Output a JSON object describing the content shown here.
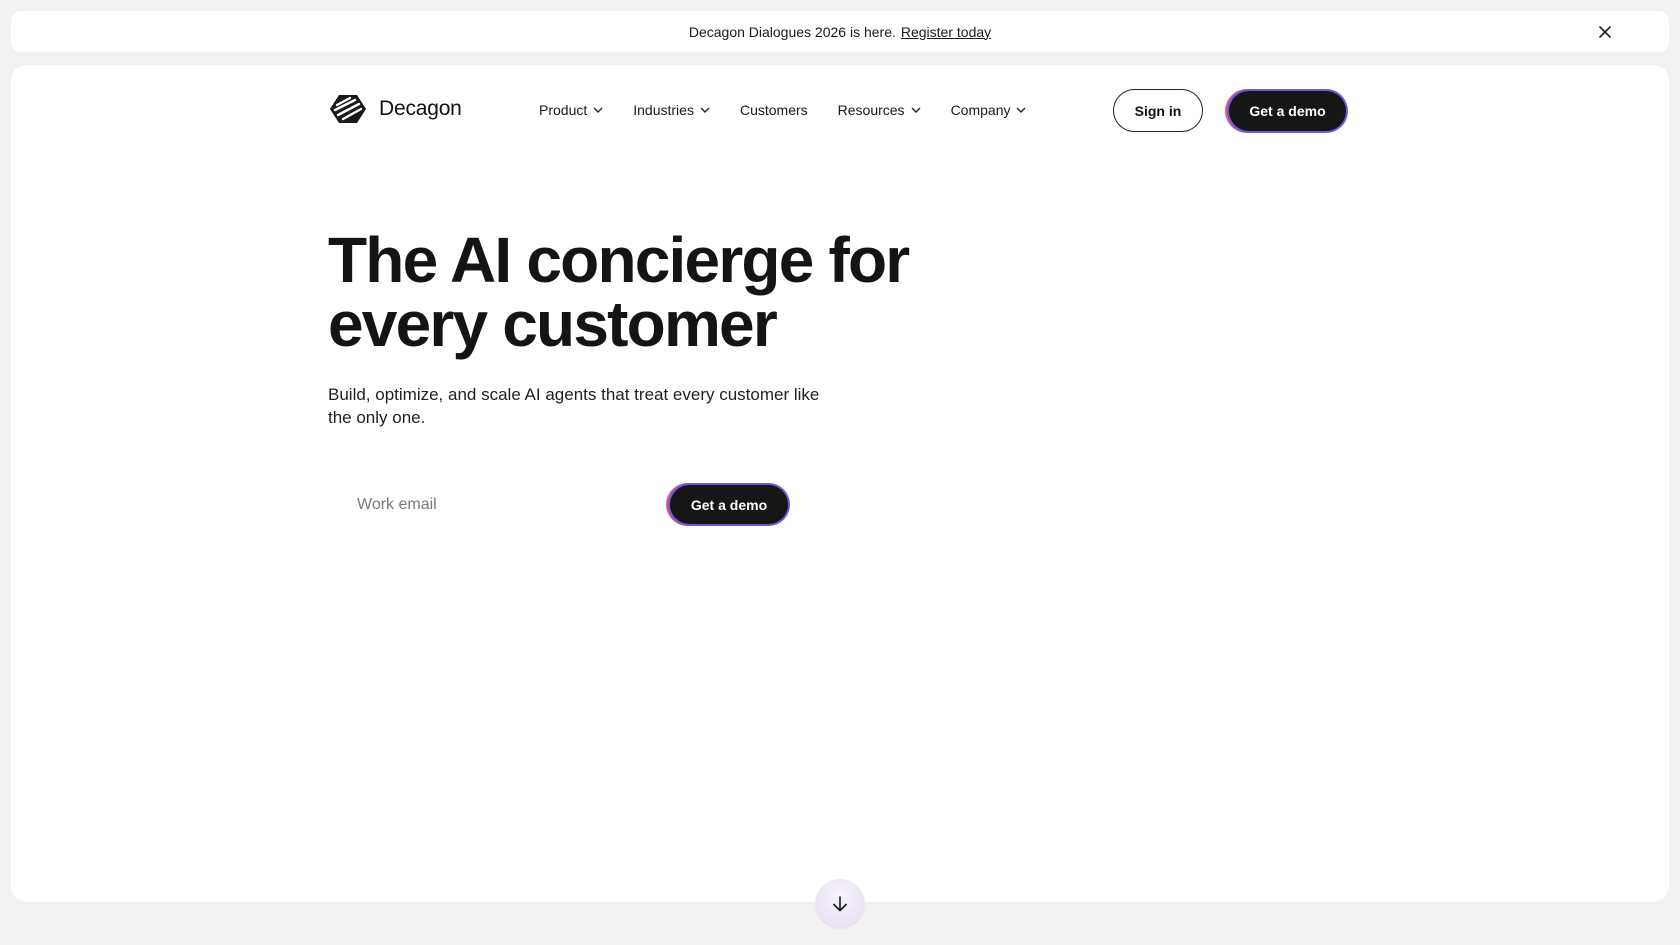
{
  "announcement": {
    "text": "Decagon Dialogues 2026 is here.",
    "link_label": "Register today",
    "close_icon": "close-icon"
  },
  "brand": {
    "name": "Decagon",
    "logo_icon": "decagon-logo-icon"
  },
  "nav": {
    "items": [
      {
        "label": "Product",
        "has_dropdown": true
      },
      {
        "label": "Industries",
        "has_dropdown": true
      },
      {
        "label": "Customers",
        "has_dropdown": false
      },
      {
        "label": "Resources",
        "has_dropdown": true
      },
      {
        "label": "Company",
        "has_dropdown": true
      }
    ],
    "signin_label": "Sign in",
    "demo_label": "Get a demo"
  },
  "hero": {
    "headline": "The AI concierge for every customer",
    "subtext": "Build, optimize, and scale AI agents that treat every customer like the only one.",
    "email_placeholder": "Work email",
    "email_value": "",
    "cta_label": "Get a demo"
  },
  "scroll": {
    "icon": "arrow-down-icon"
  },
  "colors": {
    "page_bg": "#f2f2f2",
    "card_bg": "#ffffff",
    "button_dark": "#161616",
    "button_ring_purple": "#6b5bd6",
    "button_ring_pink": "#e35a8b",
    "scroll_button_tint": "#ece6f5"
  }
}
